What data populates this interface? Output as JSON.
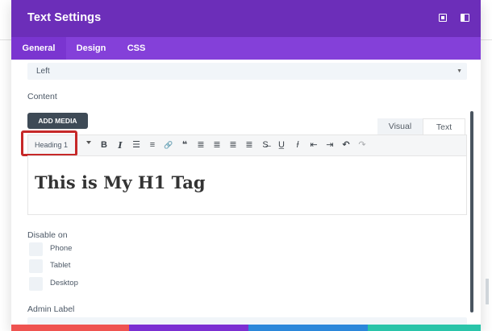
{
  "window": {
    "title": "Text Settings"
  },
  "tabs": [
    {
      "label": "General",
      "active": true
    },
    {
      "label": "Design",
      "active": false
    },
    {
      "label": "CSS",
      "active": false
    }
  ],
  "alignment_select": {
    "value": "Left"
  },
  "content": {
    "label": "Content",
    "add_media_label": "ADD MEDIA",
    "visual_tab": "Visual",
    "text_tab": "Text",
    "format_select": "Heading 1",
    "editor_text": "This is My H1 Tag"
  },
  "toolbar_icons": [
    {
      "name": "bold-icon",
      "glyph": "B"
    },
    {
      "name": "italic-icon",
      "glyph": "I"
    },
    {
      "name": "bulleted-list-icon",
      "glyph": "☰"
    },
    {
      "name": "numbered-list-icon",
      "glyph": "≡"
    },
    {
      "name": "link-icon",
      "glyph": "🔗"
    },
    {
      "name": "blockquote-icon",
      "glyph": "❝"
    },
    {
      "name": "align-left-icon",
      "glyph": "≣"
    },
    {
      "name": "align-center-icon",
      "glyph": "≣"
    },
    {
      "name": "align-right-icon",
      "glyph": "≣"
    },
    {
      "name": "align-justify-icon",
      "glyph": "≣"
    },
    {
      "name": "strikethrough-icon",
      "glyph": "S̶"
    },
    {
      "name": "underline-icon",
      "glyph": "U̲"
    },
    {
      "name": "clear-formatting-icon",
      "glyph": "Ɨ"
    },
    {
      "name": "outdent-icon",
      "glyph": "⇤"
    },
    {
      "name": "indent-icon",
      "glyph": "⇥"
    },
    {
      "name": "undo-icon",
      "glyph": "↶"
    },
    {
      "name": "redo-icon",
      "glyph": "↷"
    }
  ],
  "disable_on": {
    "label": "Disable on",
    "options": [
      "Phone",
      "Tablet",
      "Desktop"
    ]
  },
  "admin_label": {
    "label": "Admin Label",
    "value": ""
  },
  "colors": {
    "title_bar": "#6c2eb9",
    "tab_bar": "#8440d9",
    "highlight_border": "#c62828",
    "footer_cancel": "#ef5350",
    "footer_library": "#7b2fd2",
    "footer_help": "#2b87da",
    "footer_save": "#29c4a9"
  }
}
